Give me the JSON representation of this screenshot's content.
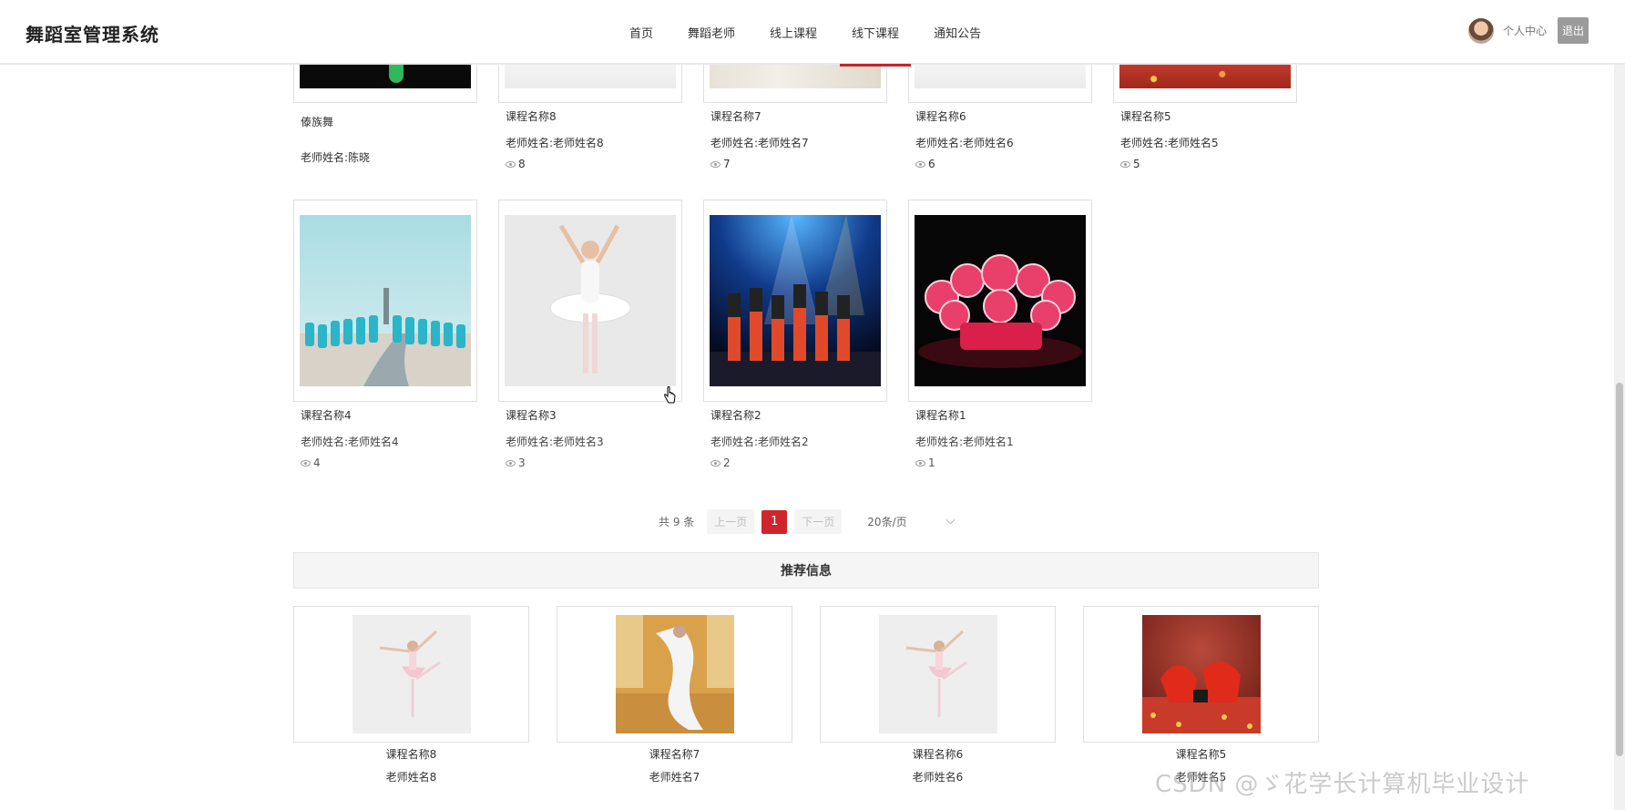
{
  "header": {
    "brand": "舞蹈室管理系统",
    "nav": [
      "首页",
      "舞蹈老师",
      "线上课程",
      "线下课程",
      "通知公告"
    ],
    "active_nav": "线下课程",
    "user_center": "个人中心",
    "logout": "退出"
  },
  "top_row": [
    {
      "title": "傣族舞",
      "teacher": "老师姓名:陈晓",
      "views": ""
    },
    {
      "title": "课程名称8",
      "teacher": "老师姓名:老师姓名8",
      "views": "8"
    },
    {
      "title": "课程名称7",
      "teacher": "老师姓名:老师姓名7",
      "views": "7"
    },
    {
      "title": "课程名称6",
      "teacher": "老师姓名:老师姓名6",
      "views": "6"
    },
    {
      "title": "课程名称5",
      "teacher": "老师姓名:老师姓名5",
      "views": "5"
    }
  ],
  "grid": [
    {
      "title": "课程名称4",
      "teacher": "老师姓名:老师姓名4",
      "views": "4"
    },
    {
      "title": "课程名称3",
      "teacher": "老师姓名:老师姓名3",
      "views": "3"
    },
    {
      "title": "课程名称2",
      "teacher": "老师姓名:老师姓名2",
      "views": "2"
    },
    {
      "title": "课程名称1",
      "teacher": "老师姓名:老师姓名1",
      "views": "1"
    }
  ],
  "pager": {
    "total": "共 9 条",
    "prev": "上一页",
    "page": "1",
    "next": "下一页",
    "size": "20条/页"
  },
  "recommend": {
    "title": "推荐信息",
    "items": [
      {
        "title": "课程名称8",
        "teacher": "老师姓名8"
      },
      {
        "title": "课程名称7",
        "teacher": "老师姓名7"
      },
      {
        "title": "课程名称6",
        "teacher": "老师姓名6"
      },
      {
        "title": "课程名称5",
        "teacher": "老师姓名5"
      }
    ]
  },
  "watermark": "CSDN @ゞ花学长计算机毕业设计",
  "colors": {
    "accent": "#c0262d",
    "page_active": "#d0252a"
  }
}
